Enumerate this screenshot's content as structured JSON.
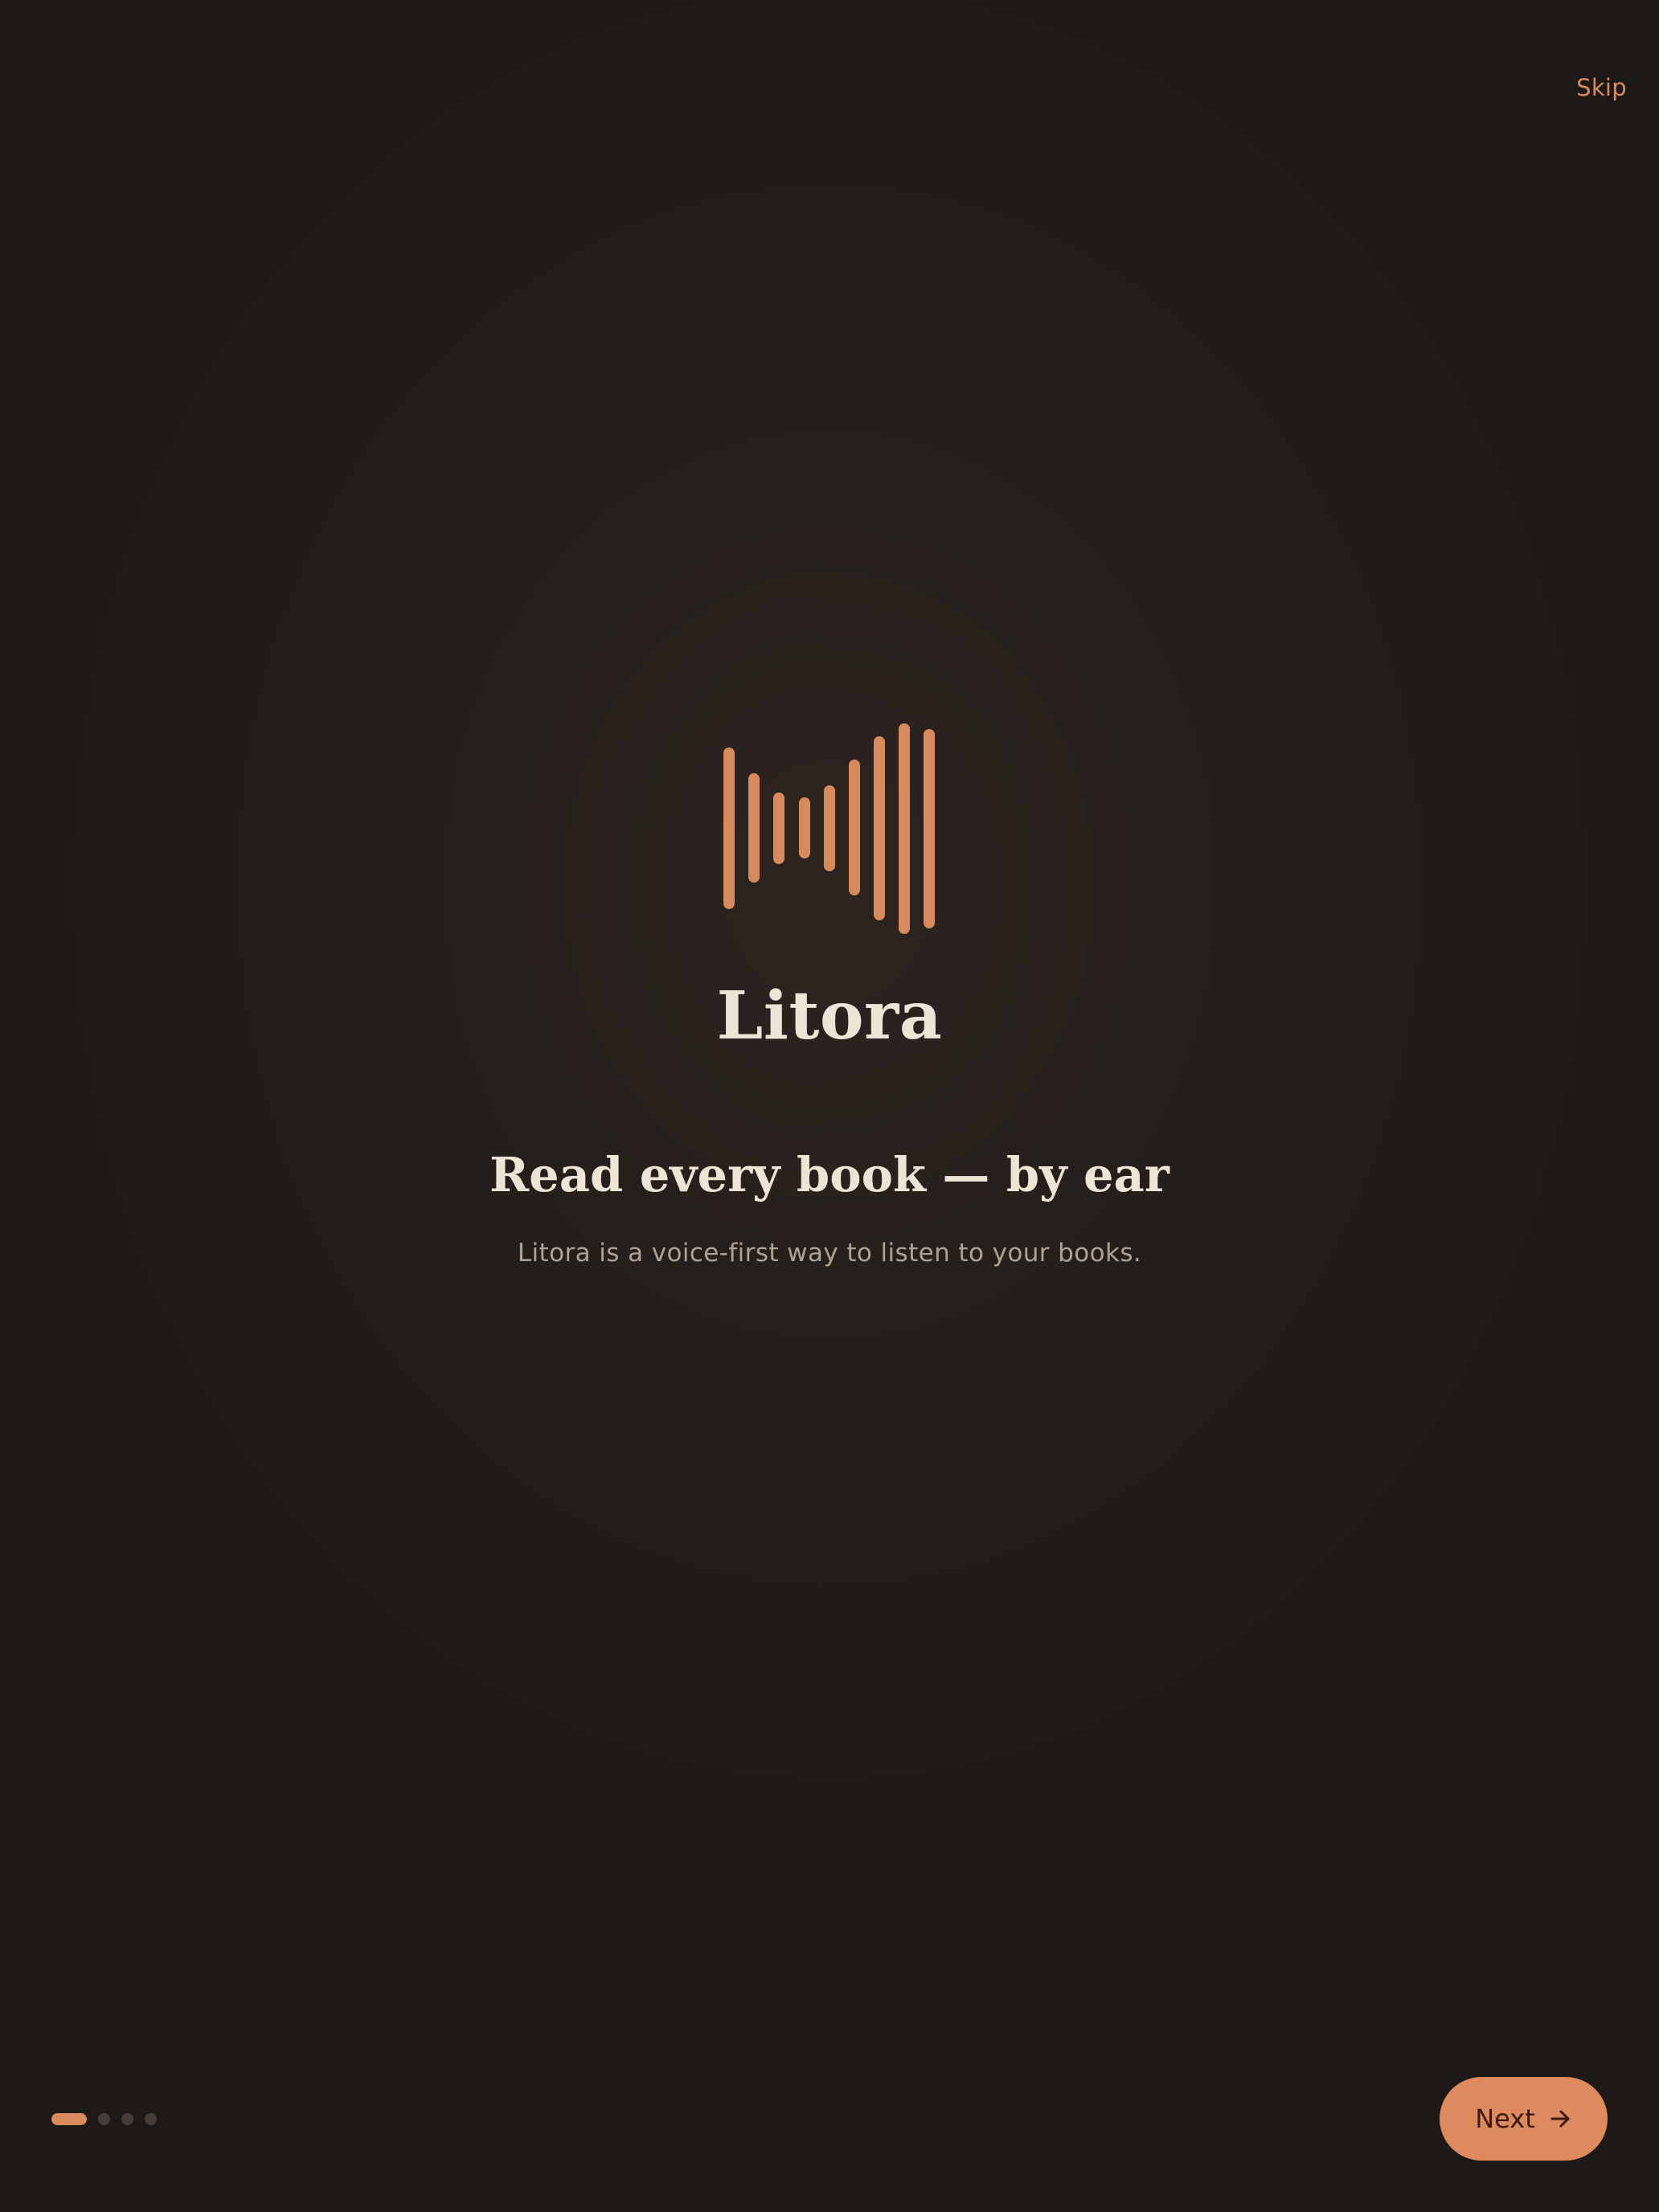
{
  "header": {
    "skip_label": "Skip"
  },
  "brand": {
    "name": "Litora",
    "logo_icon": "waveform-icon"
  },
  "hero": {
    "headline": "Read every book — by ear",
    "subtitle": "Litora is a voice-first way to listen to your books."
  },
  "pager": {
    "total_pages": 4,
    "current_page": 1
  },
  "footer": {
    "next_label": "Next",
    "next_icon": "arrow-right-icon"
  },
  "colors": {
    "accent": "#dc8a5e",
    "background": "#241e1a",
    "text_primary": "#eee4d6",
    "text_secondary": "#ada295",
    "dot_inactive": "#463c36"
  }
}
